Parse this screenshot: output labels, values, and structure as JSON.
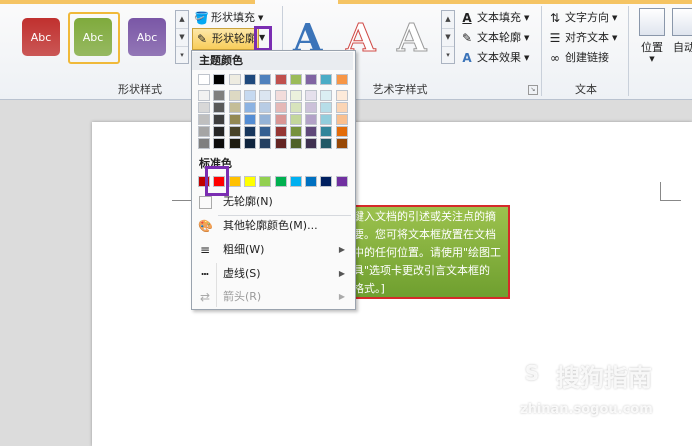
{
  "ribbon": {
    "shape_styles": {
      "group_label": "形状样式",
      "samples": [
        {
          "label": "Abc",
          "color": "#c0302e",
          "selected": false
        },
        {
          "label": "Abc",
          "color": "#7faa3c",
          "selected": true
        },
        {
          "label": "Abc",
          "color": "#7a57a6",
          "selected": false
        }
      ],
      "shape_fill_label": "形状填充",
      "shape_outline_label": "形状轮廓",
      "gallery_up": "▲",
      "gallery_down": "▼",
      "gallery_more": "▾"
    },
    "wordart_styles": {
      "group_label": "艺术字样式",
      "samples": [
        {
          "glyph": "A",
          "style": "blue"
        },
        {
          "glyph": "A",
          "style": "red-outline"
        },
        {
          "glyph": "A",
          "style": "gray-outline"
        }
      ],
      "text_fill_label": "文本填充",
      "text_outline_label": "文本轮廓",
      "text_effects_label": "文本效果"
    },
    "text": {
      "group_label": "文本",
      "direction_label": "文字方向",
      "align_label": "对齐文本",
      "link_label": "创建链接"
    },
    "arrange": {
      "position_label": "位置",
      "auto_wrap_label": "自动"
    }
  },
  "menu": {
    "theme_colors_label": "主题颜色",
    "theme_top_row": [
      "#ffffff",
      "#000000",
      "#eeece1",
      "#1f497d",
      "#4f81bd",
      "#c0504d",
      "#9bbb59",
      "#8064a2",
      "#4bacc6",
      "#f79646"
    ],
    "theme_shades": [
      [
        "#f2f2f2",
        "#7f7f7f",
        "#ddd9c3",
        "#c6d9f0",
        "#dbe5f1",
        "#f2dcdb",
        "#ebf1dd",
        "#e5e0ec",
        "#dbeef3",
        "#fdeada"
      ],
      [
        "#d8d8d8",
        "#595959",
        "#c4bd97",
        "#8db3e2",
        "#b8cce4",
        "#e5b9b7",
        "#d7e3bc",
        "#ccc1d9",
        "#b7dde8",
        "#fbd5b5"
      ],
      [
        "#bfbfbf",
        "#3f3f3f",
        "#938953",
        "#548dd4",
        "#95b3d7",
        "#d99694",
        "#c3d69b",
        "#b2a2c7",
        "#92cddc",
        "#fac08f"
      ],
      [
        "#a5a5a5",
        "#262626",
        "#494429",
        "#17365d",
        "#366092",
        "#953734",
        "#76923c",
        "#5f497a",
        "#31859b",
        "#e36c09"
      ],
      [
        "#7f7f7f",
        "#0c0c0c",
        "#1d1b10",
        "#0f243e",
        "#244061",
        "#632423",
        "#4f6128",
        "#3f3151",
        "#205867",
        "#974806"
      ]
    ],
    "standard_colors_label": "标准色",
    "standard_colors": [
      "#c00000",
      "#ff0000",
      "#ffc000",
      "#ffff00",
      "#92d050",
      "#00b050",
      "#00b0f0",
      "#0070c0",
      "#002060",
      "#7030a0"
    ],
    "selected_standard_index": 1,
    "items": [
      {
        "label": "无轮廓(N)",
        "icon": "no-outline-icon",
        "has_submenu": false,
        "disabled": false
      },
      {
        "label": "其他轮廓颜色(M)...",
        "icon": "palette-icon",
        "has_submenu": false,
        "disabled": false
      },
      {
        "label": "粗细(W)",
        "icon": "line-weight-icon",
        "has_submenu": true,
        "disabled": false
      },
      {
        "label": "虚线(S)",
        "icon": "dashes-icon",
        "has_submenu": true,
        "disabled": false
      },
      {
        "label": "箭头(R)",
        "icon": "arrows-icon",
        "has_submenu": true,
        "disabled": true
      }
    ]
  },
  "document": {
    "textbox_lines": [
      "键入文档的引述或关注点的摘",
      "要。您可将文本框放置在文档",
      "中的任何位置。请使用\"绘图工",
      "具\"选项卡更改引言文本框的",
      "格式。]"
    ],
    "textbox_fill": "#84b03d",
    "textbox_border": "#d52a2a"
  },
  "watermark": {
    "brand": "搜狗指南",
    "url": "zhinan.sogou.com"
  },
  "colors": {
    "highlight": "#7a2db2",
    "active_button": "#f8cd5a"
  }
}
